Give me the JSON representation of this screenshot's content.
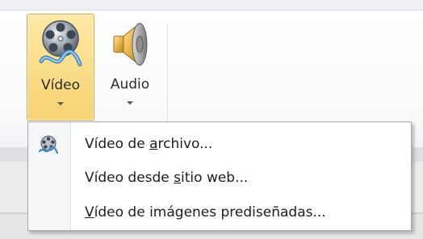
{
  "ribbon": {
    "video_button": {
      "label": "Vídeo",
      "icon": "film-reel-icon"
    },
    "audio_button": {
      "label": "Audio",
      "icon": "speaker-icon"
    }
  },
  "menu": {
    "items": [
      {
        "label": "Vídeo de archivo...",
        "pre": "Vídeo de ",
        "key": "a",
        "post": "rchivo...",
        "icon": "film-reel-small-icon"
      },
      {
        "label": "Vídeo desde sitio web...",
        "pre": "Vídeo desde ",
        "key": "s",
        "post": "itio web...",
        "icon": ""
      },
      {
        "label": "Vídeo de imágenes prediseñadas...",
        "pre": "",
        "key": "V",
        "post": "ídeo de imágenes prediseñadas...",
        "icon": ""
      }
    ]
  },
  "colors": {
    "selected_fill": "#fbdf8c",
    "selected_border": "#d9a84a",
    "menu_border": "#a7abb0"
  }
}
